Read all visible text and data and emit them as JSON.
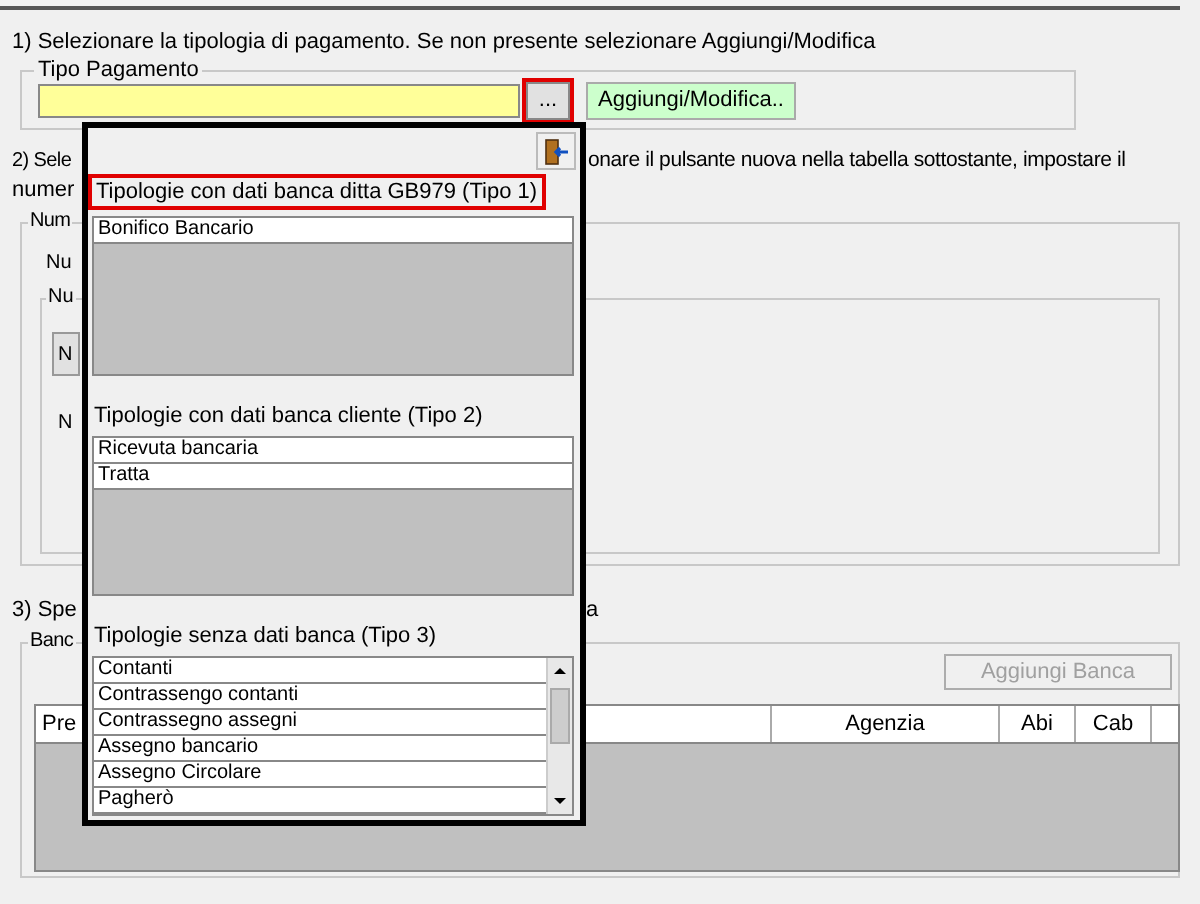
{
  "instruction_1": "1) Selezionare la tipologia di pagamento. Se non presente selezionare Aggiungi/Modifica",
  "tipo_pagamento": {
    "label": "Tipo Pagamento",
    "browse_button": {
      "label": "...",
      "highlighted": true
    },
    "add_button": "Aggiungi/Modifica.."
  },
  "instruction_2": {
    "left": "2) Sele",
    "right": "onare il pulsante nuova nella tabella sottostante, impostare il",
    "line_2": "numer"
  },
  "group_2": {
    "label": "Num",
    "text_1": "Nu",
    "inner_label": "Nu",
    "button": "N",
    "text_2": "N"
  },
  "instruction_3": {
    "left": "3) Spe",
    "right": "a"
  },
  "banks": {
    "label": "Banc",
    "add_button": {
      "label": "Aggiungi Banca",
      "disabled": true
    },
    "columns": [
      "Pre",
      "Agenzia",
      "Abi",
      "Cab"
    ]
  },
  "popup": {
    "sections": [
      {
        "title": "Tipologie con dati banca ditta GB979 (Tipo 1)",
        "highlighted": true,
        "scrollbar": false,
        "items": [
          "Bonifico Bancario"
        ]
      },
      {
        "title": "Tipologie con dati banca cliente (Tipo 2)",
        "highlighted": false,
        "scrollbar": false,
        "items": [
          "Ricevuta bancaria",
          "Tratta"
        ]
      },
      {
        "title": "Tipologie senza dati banca (Tipo 3)",
        "highlighted": false,
        "scrollbar": true,
        "items": [
          "Contanti",
          "Contrassengo contanti",
          "Contrassegno assegni",
          "Assegno bancario",
          "Assegno Circolare",
          "Pagherò"
        ]
      }
    ]
  }
}
